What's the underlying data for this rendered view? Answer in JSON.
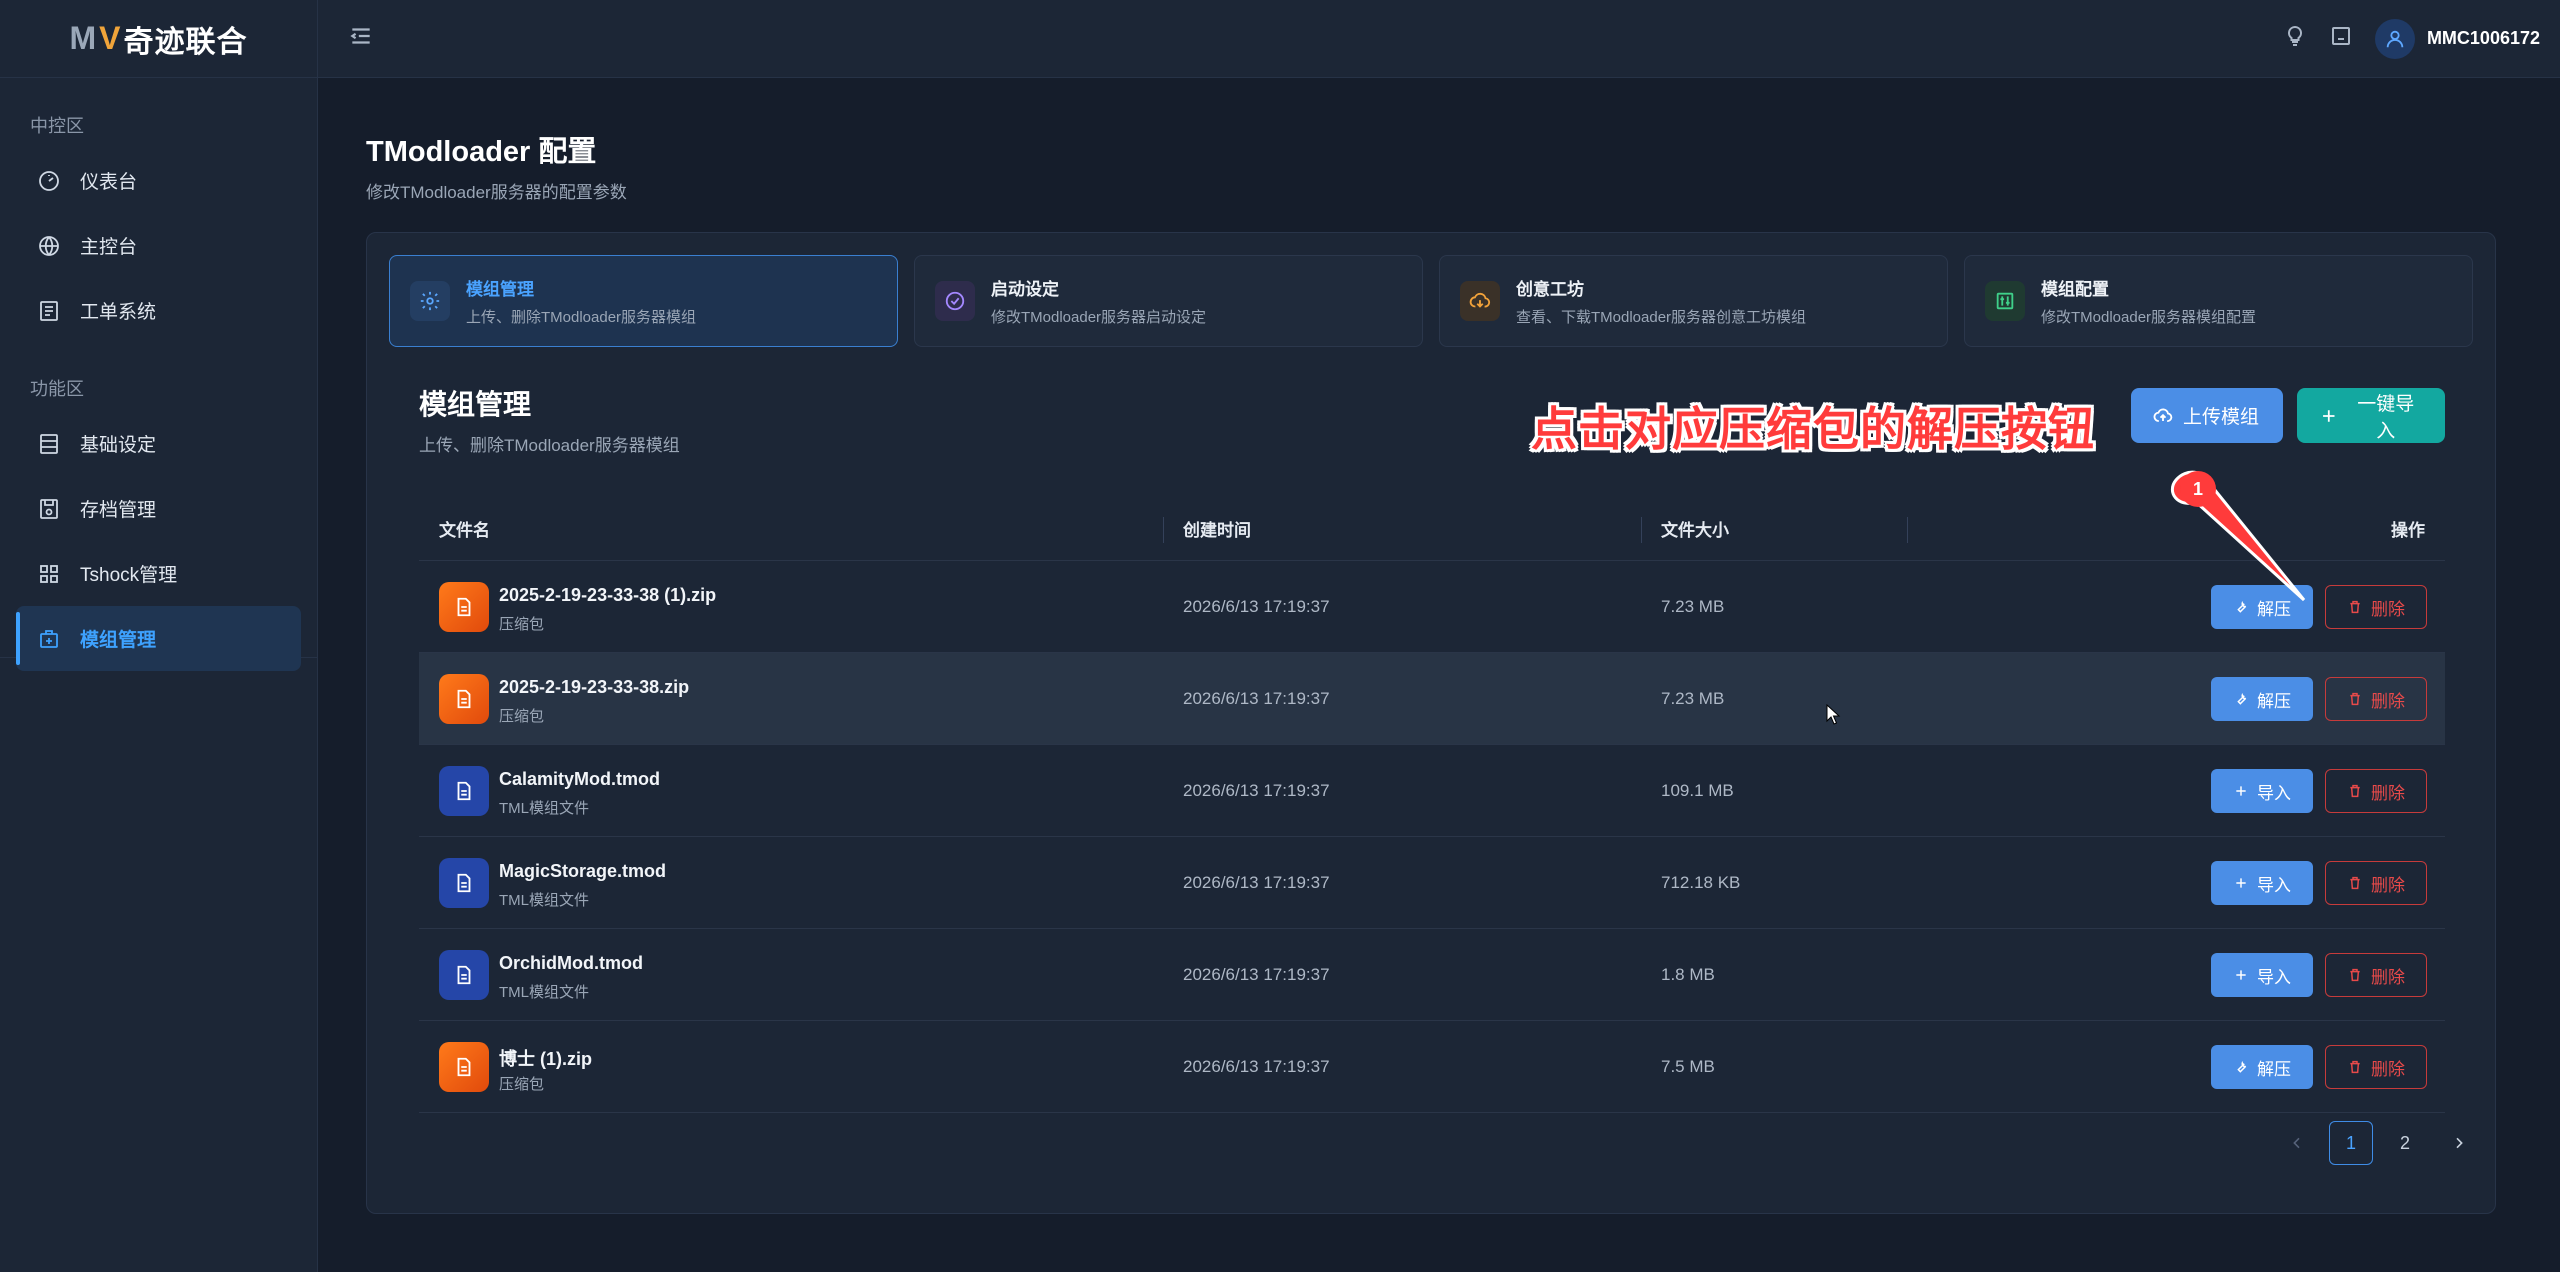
{
  "brand": {
    "logo_text": "奇迹联合",
    "logo_m": "M",
    "logo_v": "V"
  },
  "sidebar": {
    "groups": [
      {
        "label": "中控区"
      },
      {
        "label": "功能区"
      }
    ],
    "items": [
      {
        "label": "仪表台",
        "icon": "gauge-icon"
      },
      {
        "label": "主控台",
        "icon": "globe-icon"
      },
      {
        "label": "工单系统",
        "icon": "list-icon"
      },
      {
        "label": "基础设定",
        "icon": "server-icon"
      },
      {
        "label": "存档管理",
        "icon": "save-icon"
      },
      {
        "label": "Tshock管理",
        "icon": "grid-icon"
      },
      {
        "label": "模组管理",
        "icon": "mod-box-icon",
        "active": true
      }
    ]
  },
  "topbar": {
    "username": "MMC1006172"
  },
  "page": {
    "title": "TModloader 配置",
    "subtitle": "修改TModloader服务器的配置参数"
  },
  "tabs": [
    {
      "title": "模组管理",
      "desc": "上传、删除TModloader服务器模组",
      "icon": "gear-icon",
      "active": true
    },
    {
      "title": "启动设定",
      "desc": "修改TModloader服务器启动设定",
      "icon": "check-circle-icon"
    },
    {
      "title": "创意工坊",
      "desc": "查看、下载TModloader服务器创意工坊模组",
      "icon": "cloud-download-icon"
    },
    {
      "title": "模组配置",
      "desc": "修改TModloader服务器模组配置",
      "icon": "sliders-icon"
    }
  ],
  "section": {
    "title": "模组管理",
    "subtitle": "上传、删除TModloader服务器模组",
    "upload_label": "上传模组",
    "import_all_label": "一键导入"
  },
  "annotation": {
    "text": "点击对应压缩包的解压按钮",
    "badge": "1",
    "color": "#ff3b3b"
  },
  "table": {
    "headers": {
      "name": "文件名",
      "time": "创建时间",
      "size": "文件大小",
      "ops": "操作"
    },
    "rows": [
      {
        "name": "2025-2-19-23-33-38 (1).zip",
        "type": "压缩包",
        "time": "2026/6/13 17:19:37",
        "size": "7.23 MB",
        "action": "解压",
        "delete": "删除"
      },
      {
        "name": "2025-2-19-23-33-38.zip",
        "type": "压缩包",
        "time": "2026/6/13 17:19:37",
        "size": "7.23 MB",
        "action": "解压",
        "delete": "删除"
      },
      {
        "name": "CalamityMod.tmod",
        "type": "TML模组文件",
        "time": "2026/6/13 17:19:37",
        "size": "109.1 MB",
        "action": "导入",
        "delete": "删除"
      },
      {
        "name": "MagicStorage.tmod",
        "type": "TML模组文件",
        "time": "2026/6/13 17:19:37",
        "size": "712.18 KB",
        "action": "导入",
        "delete": "删除"
      },
      {
        "name": "OrchidMod.tmod",
        "type": "TML模组文件",
        "time": "2026/6/13 17:19:37",
        "size": "1.8 MB",
        "action": "导入",
        "delete": "删除"
      },
      {
        "name": "博士 (1).zip",
        "type": "压缩包",
        "time": "2026/6/13 17:19:37",
        "size": "7.5 MB",
        "action": "解压",
        "delete": "删除"
      }
    ]
  },
  "pagination": {
    "pages": [
      "1",
      "2"
    ],
    "current": "1"
  },
  "colors": {
    "accent": "#3ea2ff",
    "primary_button": "#4b8ee6",
    "teal_button": "#13a8a0",
    "danger": "#e84a4a"
  }
}
